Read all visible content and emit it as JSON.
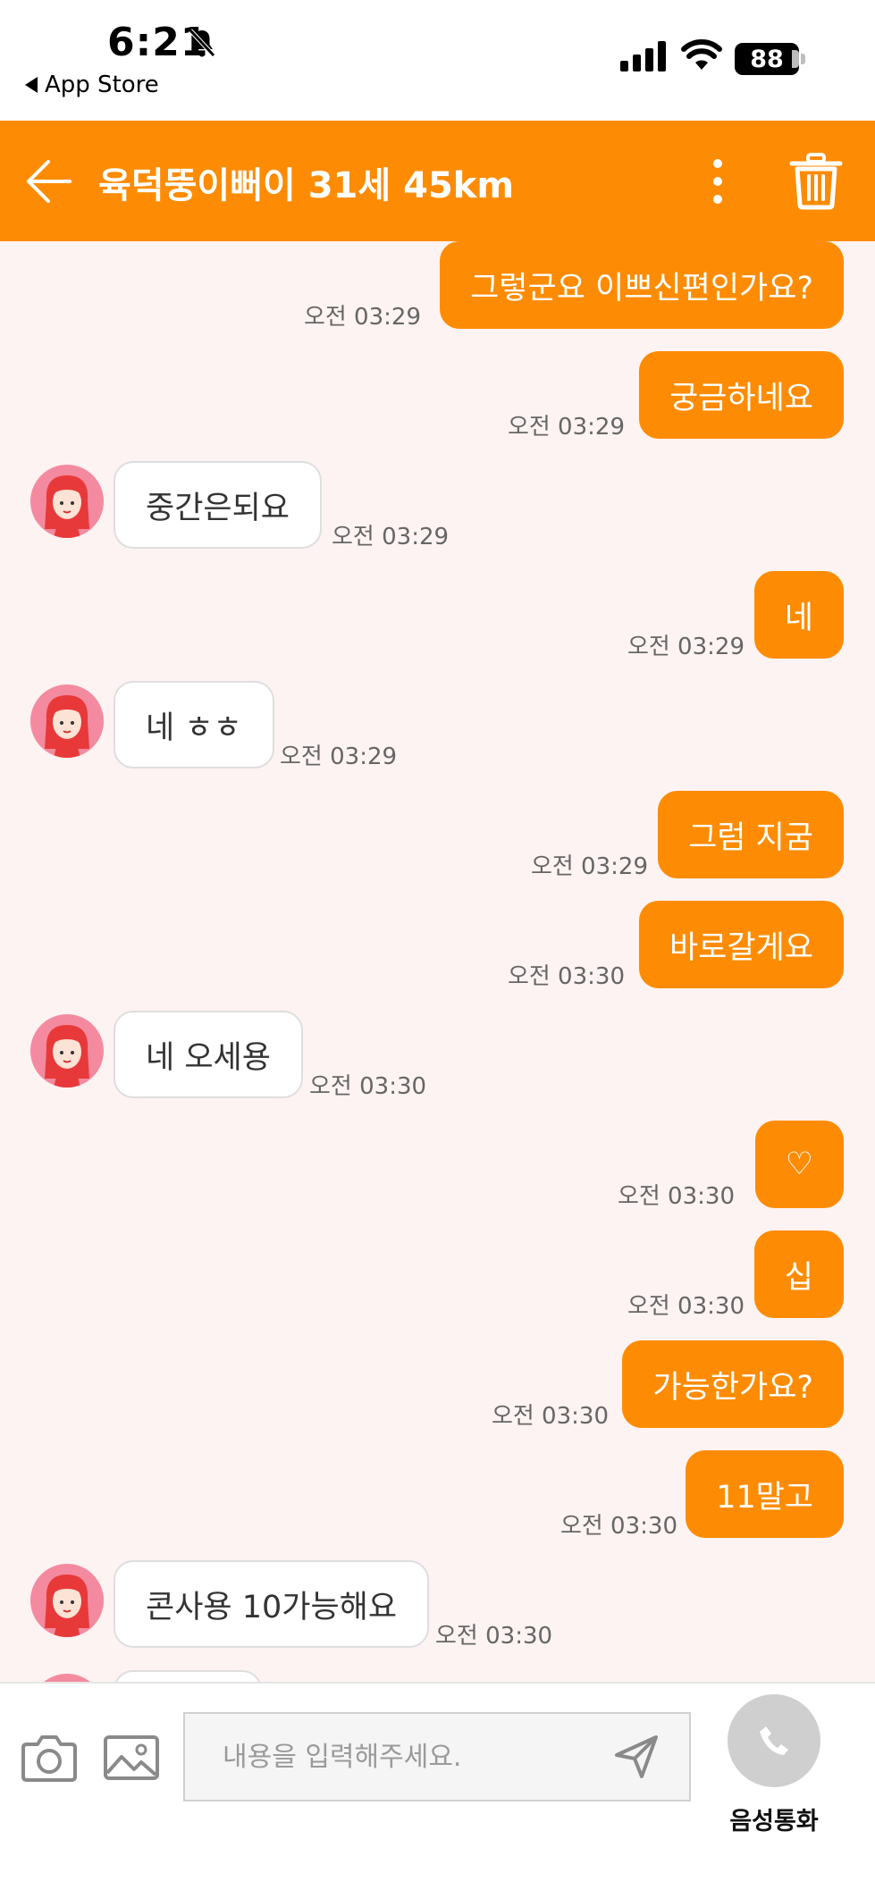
{
  "status_bar": {
    "time": "6:21",
    "back_app": "App Store",
    "battery": "88"
  },
  "header": {
    "title": "육덕뚱이뻐이 31세 45km"
  },
  "colors": {
    "accent": "#fd8c04",
    "chat_background": "#fdf3f2"
  },
  "messages": [
    {
      "sender": "me",
      "text": "그렇군요 이쁘신편인가요?",
      "time": "오전 03:29"
    },
    {
      "sender": "me",
      "text": "궁금하네요",
      "time": "오전 03:29"
    },
    {
      "sender": "other",
      "text": "중간은되요",
      "time": "오전 03:29"
    },
    {
      "sender": "me",
      "text": "네",
      "time": "오전 03:29"
    },
    {
      "sender": "other",
      "text": "네 ㅎㅎ",
      "time": "오전 03:29"
    },
    {
      "sender": "me",
      "text": "그럼 지굼",
      "time": "오전 03:29"
    },
    {
      "sender": "me",
      "text": "바로갈게요",
      "time": "오전 03:30"
    },
    {
      "sender": "other",
      "text": "네 오세용",
      "time": "오전 03:30"
    },
    {
      "sender": "me",
      "text": "♡",
      "time": "오전 03:30"
    },
    {
      "sender": "me",
      "text": "십",
      "time": "오전 03:30"
    },
    {
      "sender": "me",
      "text": "가능한가요?",
      "time": "오전 03:30"
    },
    {
      "sender": "me",
      "text": "11말고",
      "time": "오전 03:30"
    },
    {
      "sender": "other",
      "text": "콘사용 10가능해요",
      "time": "오전 03:30"
    },
    {
      "sender": "other",
      "text": "",
      "time": ""
    }
  ],
  "input_bar": {
    "placeholder": "내용을 입력해주세요.",
    "value": "",
    "call_label": "음성통화"
  },
  "icons": {
    "back": "arrow-left-icon",
    "more": "more-vertical-icon",
    "trash": "trash-icon",
    "camera": "camera-icon",
    "gallery": "image-icon",
    "send": "send-icon",
    "call": "phone-icon",
    "avatar": "avatar-icon"
  }
}
